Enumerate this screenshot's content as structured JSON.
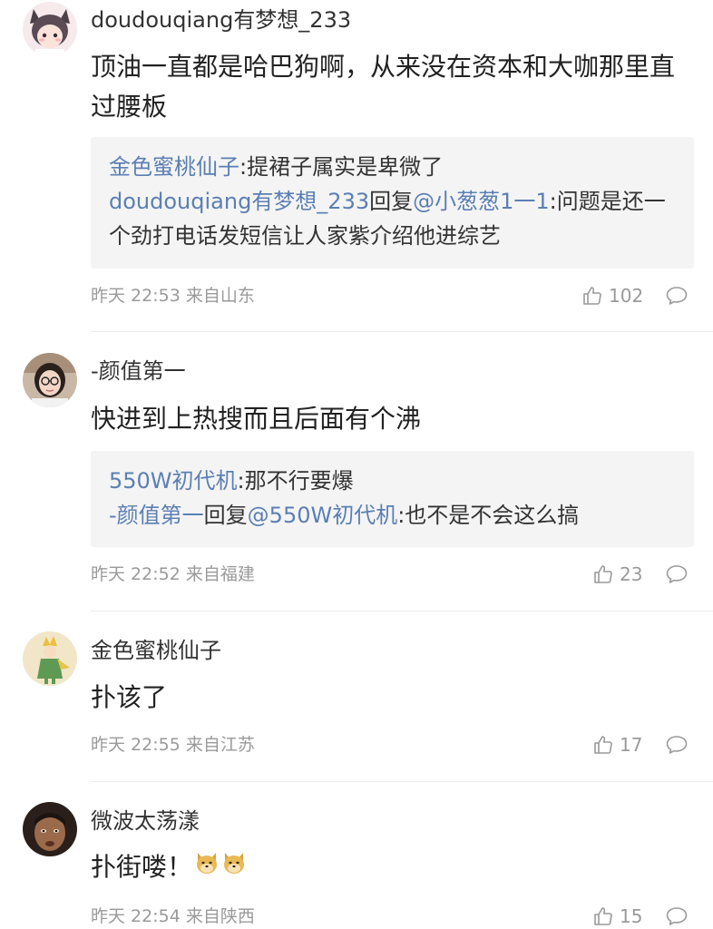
{
  "comments": [
    {
      "username": "doudouqiang有梦想_233",
      "content": "顶油一直都是哈巴狗啊，从来没在资本和大咖那里直过腰板",
      "replies": [
        {
          "author": "金色蜜桃仙子",
          "reply_to": "",
          "text": ":提裙子属实是卑微了"
        },
        {
          "author": "doudouqiang有梦想_233",
          "reply_word": "回复",
          "reply_to": "@小葱葱1一1",
          "text": ":问题是还一个劲打电话发短信让人家紫介绍他进综艺"
        }
      ],
      "time": "昨天 22:53",
      "location": "来自山东",
      "likes": "102",
      "avatar_icon": "anime-cat-girl-avatar-icon"
    },
    {
      "username": "-颜值第一",
      "content": "快进到上热搜而且后面有个沸",
      "replies": [
        {
          "author": "550W初代机",
          "reply_to": "",
          "text": ":那不行要爆"
        },
        {
          "author": "-颜值第一",
          "reply_word": "回复",
          "reply_to": "@550W初代机",
          "text": ":也不是不会这么搞"
        }
      ],
      "time": "昨天 22:52",
      "location": "来自福建",
      "likes": "23",
      "avatar_icon": "girl-with-glasses-avatar-icon"
    },
    {
      "username": "金色蜜桃仙子",
      "content": "扑该了",
      "replies": [],
      "time": "昨天 22:55",
      "location": "来自江苏",
      "likes": "17",
      "avatar_icon": "little-prince-avatar-icon"
    },
    {
      "username": "微波太荡漾",
      "content": "扑街喽！",
      "replies": [],
      "time": "昨天 22:54",
      "location": "来自陕西",
      "likes": "15",
      "avatar_icon": "man-face-avatar-icon",
      "emoji_icons": [
        "doge-emoji-icon",
        "doge-emoji-icon"
      ]
    }
  ],
  "colors": {
    "link_blue": "#5b7fb3",
    "meta_gray": "#9a9a9a",
    "reply_bg": "#f4f4f4"
  }
}
